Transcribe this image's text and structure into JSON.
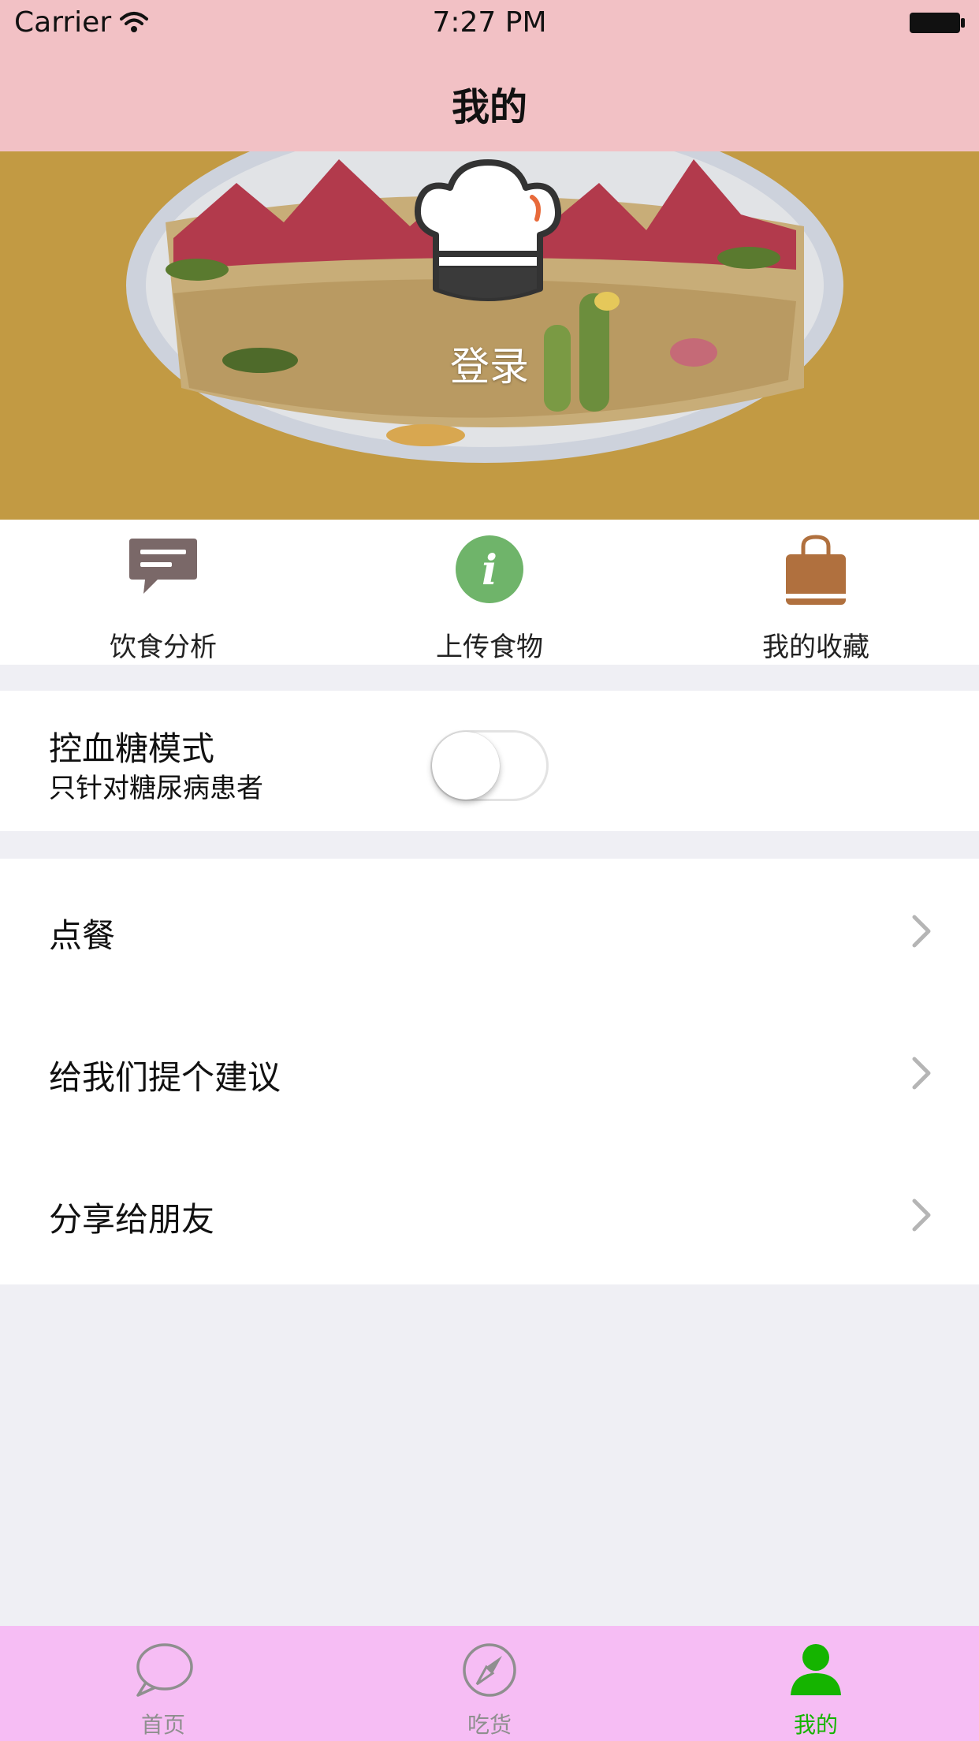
{
  "status_bar": {
    "carrier": "Carrier",
    "time": "7:27 PM"
  },
  "nav": {
    "title": "我的"
  },
  "hero": {
    "login_label": "登录"
  },
  "shortcuts": [
    {
      "label": "饮食分析",
      "icon": "message-icon",
      "color": "#7a6868"
    },
    {
      "label": "上传食物",
      "icon": "info-icon",
      "color": "#6fb46a"
    },
    {
      "label": "我的收藏",
      "icon": "bag-icon",
      "color": "#b0703e"
    }
  ],
  "glucose_mode": {
    "title": "控血糖模式",
    "subtitle": "只针对糖尿病患者",
    "enabled": false
  },
  "menu": [
    {
      "label": "点餐"
    },
    {
      "label": "给我们提个建议"
    },
    {
      "label": "分享给朋友"
    }
  ],
  "tabbar": {
    "active_color": "#15b400",
    "tabs": [
      {
        "label": "首页",
        "icon": "chat-bubble-icon",
        "active": false
      },
      {
        "label": "吃货",
        "icon": "compass-icon",
        "active": false
      },
      {
        "label": "我的",
        "icon": "person-icon",
        "active": true
      }
    ]
  }
}
